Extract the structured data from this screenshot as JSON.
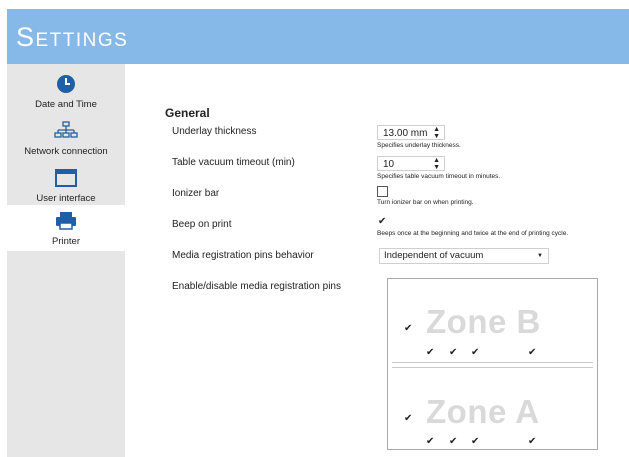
{
  "header": {
    "title": "Settings"
  },
  "sidebar": {
    "items": [
      {
        "label": "Date and Time",
        "icon": "clock-icon"
      },
      {
        "label": "Network connection",
        "icon": "network-icon"
      },
      {
        "label": "User interface",
        "icon": "monitor-icon"
      },
      {
        "label": "Printer",
        "icon": "printer-icon",
        "active": true
      }
    ]
  },
  "general": {
    "title": "General",
    "underlay": {
      "label": "Underlay thickness",
      "value": "13.00 mm",
      "hint": "Specifies underlay thickness."
    },
    "vacuum": {
      "label": "Table vacuum timeout (min)",
      "value": "10",
      "hint": "Specifies table vacuum timeout in minutes."
    },
    "ionizer": {
      "label": "Ionizer bar",
      "checked": false,
      "hint": "Turn ionizer bar on when printing."
    },
    "beep": {
      "label": "Beep on print",
      "checked": true,
      "hint": "Beeps once at the beginning and twice at the end of printing cycle."
    },
    "pins_behavior": {
      "label": "Media registration pins behavior",
      "value": "Independent of vacuum"
    },
    "pins_enable": {
      "label": "Enable/disable media registration pins"
    }
  },
  "zones": [
    {
      "name": "Zone B",
      "enabled": true,
      "pins": [
        true,
        true,
        true,
        true
      ]
    },
    {
      "name": "Zone A",
      "enabled": true,
      "pins": [
        true,
        true,
        true,
        true
      ]
    }
  ],
  "colors": {
    "header": "#86b9e7",
    "icon_blue": "#1f5fa8",
    "sidebar": "#e6e6e6"
  }
}
